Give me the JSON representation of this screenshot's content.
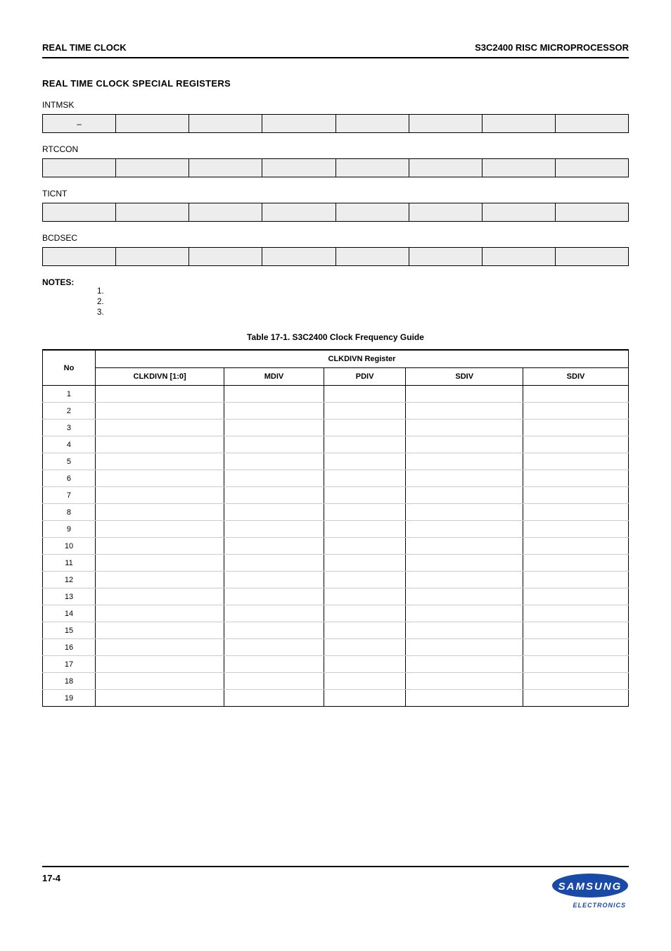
{
  "header": {
    "left": "REAL TIME CLOCK",
    "right": "S3C2400 RISC MICROPROCESSOR"
  },
  "section_title": "REAL TIME CLOCK SPECIAL REGISTERS",
  "registers": [
    {
      "label": "INTMSK",
      "cells": [
        "–",
        "",
        "",
        "",
        "",
        "",
        "",
        ""
      ]
    },
    {
      "label": "RTCCON",
      "cells": [
        "",
        "",
        "",
        "",
        "",
        "",
        "",
        ""
      ]
    },
    {
      "label": "TICNT",
      "cells": [
        "",
        "",
        "",
        "",
        "",
        "",
        "",
        ""
      ]
    },
    {
      "label": "BCDSEC",
      "cells": [
        "",
        "",
        "",
        "",
        "",
        "",
        "",
        ""
      ]
    }
  ],
  "notes_label": "NOTES:",
  "notes": [
    "1.",
    "2.",
    "3."
  ],
  "table_caption": "Table 17-1. S3C2400 Clock Frequency Guide",
  "main_table": {
    "header1": [
      "No",
      "CLKDIVN Register"
    ],
    "header2": [
      "",
      "CLKDIVN [1:0]",
      "MDIV",
      "PDIV",
      "SDIV",
      "SDIV"
    ],
    "rows": [
      [
        "1",
        "",
        "",
        "",
        "",
        ""
      ],
      [
        "2",
        "",
        "",
        "",
        "",
        ""
      ],
      [
        "3",
        "",
        "",
        "",
        "",
        ""
      ],
      [
        "4",
        "",
        "",
        "",
        "",
        ""
      ],
      [
        "5",
        "",
        "",
        "",
        "",
        ""
      ],
      [
        "6",
        "",
        "",
        "",
        "",
        ""
      ],
      [
        "7",
        "",
        "",
        "",
        "",
        ""
      ],
      [
        "8",
        "",
        "",
        "",
        "",
        ""
      ],
      [
        "9",
        "",
        "",
        "",
        "",
        ""
      ],
      [
        "10",
        "",
        "",
        "",
        "",
        ""
      ],
      [
        "11",
        "",
        "",
        "",
        "",
        ""
      ],
      [
        "12",
        "",
        "",
        "",
        "",
        ""
      ],
      [
        "13",
        "",
        "",
        "",
        "",
        ""
      ],
      [
        "14",
        "",
        "",
        "",
        "",
        ""
      ],
      [
        "15",
        "",
        "",
        "",
        "",
        ""
      ],
      [
        "16",
        "",
        "",
        "",
        "",
        ""
      ],
      [
        "17",
        "",
        "",
        "",
        "",
        ""
      ],
      [
        "18",
        "",
        "",
        "",
        "",
        ""
      ],
      [
        "19",
        "",
        "",
        "",
        "",
        ""
      ]
    ]
  },
  "footer": {
    "page": "17-4",
    "logo_text": "SAMSUNG",
    "logo_sub": "ELECTRONICS"
  }
}
